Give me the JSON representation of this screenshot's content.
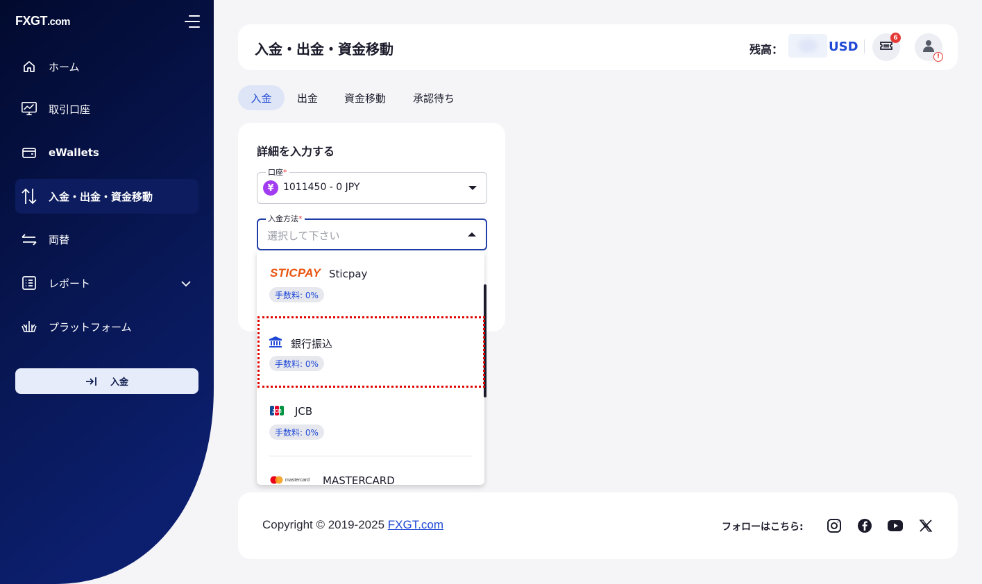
{
  "brand": {
    "logo_main": "FXGT",
    "logo_suffix": ".com"
  },
  "sidebar": {
    "items": [
      {
        "label": "ホーム",
        "icon": "home-icon"
      },
      {
        "label": "取引口座",
        "icon": "chart-monitor-icon"
      },
      {
        "label": "eWallets",
        "icon": "wallet-icon"
      },
      {
        "label": "入金・出金・資金移動",
        "icon": "transfer-arrows-icon",
        "active": true
      },
      {
        "label": "両替",
        "icon": "exchange-icon"
      },
      {
        "label": "レポート",
        "icon": "report-list-icon"
      },
      {
        "label": "プラットフォーム",
        "icon": "platform-icon"
      }
    ],
    "deposit_button": "入金"
  },
  "header": {
    "title": "入金・出金・資金移動",
    "balance_label": "残高：",
    "currency": "USD",
    "notification_count": "6",
    "avatar_warning": "!"
  },
  "tabs": [
    "入金",
    "出金",
    "資金移動",
    "承認待ち"
  ],
  "form": {
    "title": "詳細を入力する",
    "account": {
      "label": "口座",
      "required": "*",
      "value": "1011450 - 0 JPY",
      "currency_symbol": "¥"
    },
    "method": {
      "label": "入金方法",
      "required": "*",
      "placeholder": "選択して下さい"
    }
  },
  "dropdown": {
    "options": [
      {
        "logo_text": "STICPAY",
        "name": "Sticpay",
        "fee": "手数料: 0%"
      },
      {
        "name": "銀行振込",
        "fee": "手数料: 0%"
      },
      {
        "logo_text": "JCB",
        "name": "JCB",
        "fee": "手数料: 0%"
      },
      {
        "logo_text": "mastercard",
        "name": "MASTERCARD"
      }
    ]
  },
  "footer": {
    "copyright_prefix": "Copyright © 2019-2025 ",
    "copyright_link": "FXGT.com",
    "follow_label": "フォローはこちら:"
  },
  "colors": {
    "sidebar_top": "#020a2e",
    "sidebar_bottom": "#0c1f6e",
    "accent": "#1f48d6",
    "highlight": "#e00000",
    "sticpay": "#e8550f",
    "yen": "#a23cf0"
  }
}
